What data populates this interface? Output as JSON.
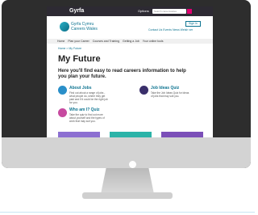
{
  "site": {
    "brand": "Gyrfa",
    "top_option": "Options",
    "search_placeholder": "Search careerswales",
    "logo_line1": "Gyrfa Cymru",
    "logo_line2": "Careers Wales",
    "sign_in": "Sign in",
    "header_links": "Contact Us   Events   News   Welsh ver"
  },
  "nav": {
    "items": [
      "Home",
      "Plan your Career",
      "Courses and Training",
      "Getting a Job",
      "Your online tools"
    ]
  },
  "page": {
    "breadcrumb": "Home  >  My Future",
    "title": "My Future",
    "intro": "Here you'll find easy to read careers information to help you plan your future."
  },
  "cards": [
    {
      "title": "About Jobs",
      "text": "Find out about a range of jobs - what people do, where they get paid and if it could be the right job for you.",
      "icon_color": "#2a8fc9"
    },
    {
      "title": "Job Ideas Quiz",
      "text": "Take the Job Ideas Quiz for ideas of jobs that may suit you.",
      "icon_color": "#3a2f6b"
    },
    {
      "title": "Who am I? Quiz",
      "text": "Take the quiz to find out more about yourself and the types of work that may suit you.",
      "icon_color": "#c74aa0"
    }
  ],
  "colors": {
    "accent": "#0e7491",
    "topbar": "#2d2a33",
    "search_button": "#e0006f",
    "thumb1": "#8c6fd1",
    "thumb2": "#2bb3a8",
    "thumb3": "#7b4fb8"
  }
}
